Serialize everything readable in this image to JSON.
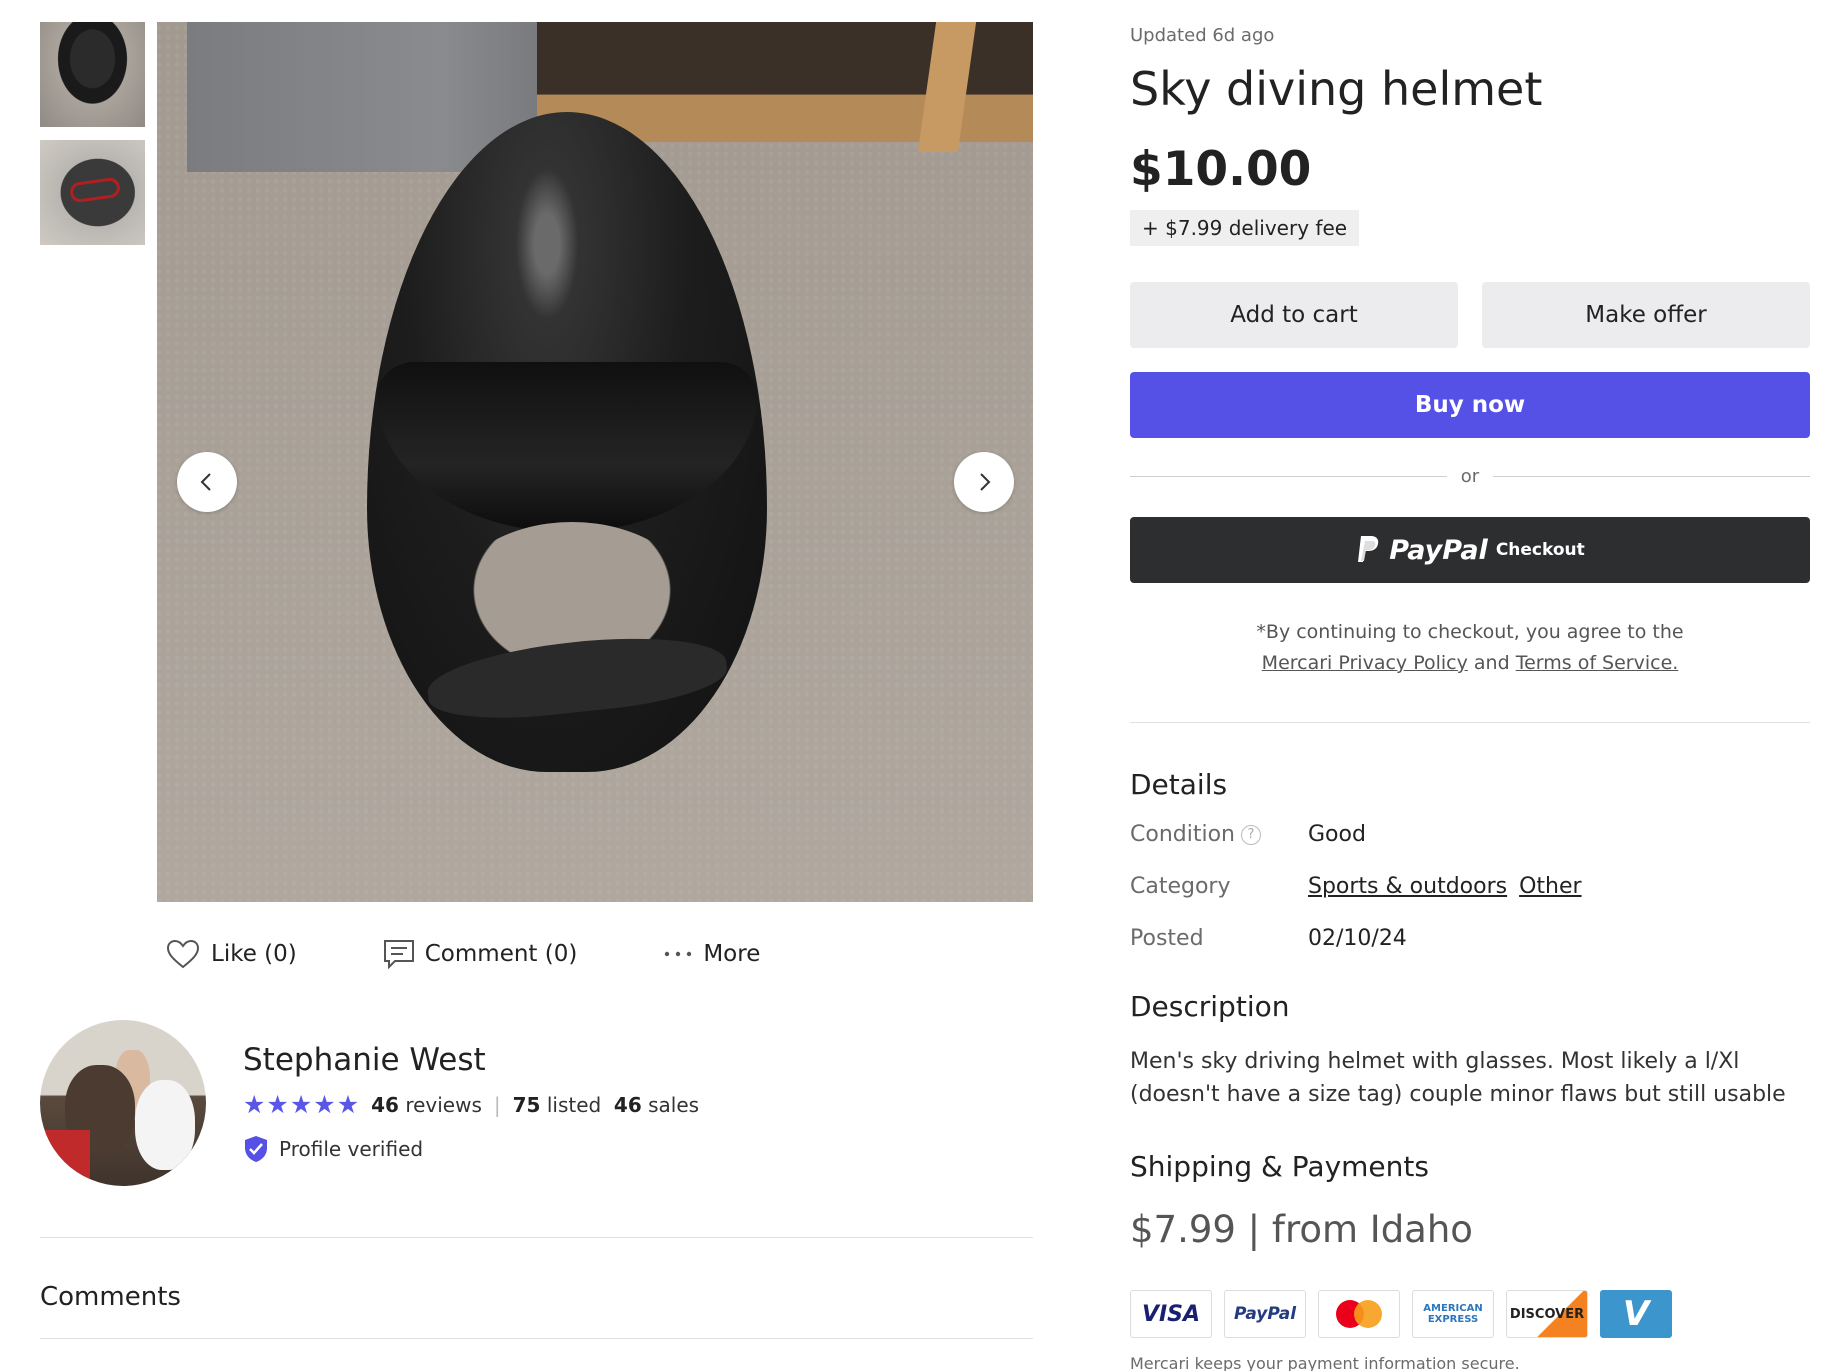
{
  "gallery": {
    "thumbnails": [
      "thumb-1",
      "thumb-2"
    ],
    "prev_icon": "chevron-left-icon",
    "next_icon": "chevron-right-icon"
  },
  "actions": {
    "like_label": "Like (0)",
    "comment_label": "Comment (0)",
    "more_label": "More"
  },
  "seller": {
    "name": "Stephanie West",
    "rating": 5,
    "reviews_count": "46",
    "reviews_label": "reviews",
    "listed_count": "75",
    "listed_label": "listed",
    "sales_count": "46",
    "sales_label": "sales",
    "verified_label": "Profile verified"
  },
  "comments": {
    "heading": "Comments"
  },
  "item": {
    "updated": "Updated 6d ago",
    "title": "Sky diving helmet",
    "price": "$10.00",
    "delivery_fee": "+ $7.99 delivery fee"
  },
  "buttons": {
    "add_to_cart": "Add to cart",
    "make_offer": "Make offer",
    "buy_now": "Buy now",
    "or": "or",
    "paypal_word": "PayPal",
    "paypal_checkout": "Checkout"
  },
  "legal": {
    "prefix": "*By continuing to checkout, you agree to the",
    "privacy_link": "Mercari Privacy Policy",
    "and": "and",
    "terms_link": "Terms of Service."
  },
  "details": {
    "heading": "Details",
    "condition_label": "Condition",
    "condition_value": "Good",
    "category_label": "Category",
    "category_1": "Sports & outdoors",
    "category_2": "Other",
    "posted_label": "Posted",
    "posted_value": "02/10/24"
  },
  "description": {
    "heading": "Description",
    "text": "Men's sky driving helmet with glasses. Most likely a l/Xl (doesn't have a size tag) couple minor flaws but still usable"
  },
  "shipping": {
    "heading": "Shipping & Payments",
    "summary": "$7.99 | from Idaho",
    "methods": {
      "visa": "VISA",
      "paypal": "PayPal",
      "mastercard": "MasterCard",
      "amex": "AMERICAN EXPRESS",
      "discover": "DISCOVER",
      "venmo": "V"
    },
    "secure_note": "Mercari keeps your payment information secure."
  },
  "colors": {
    "accent": "#5551e6",
    "star": "#5b57e6",
    "paypal_button": "#2c2e2f"
  }
}
